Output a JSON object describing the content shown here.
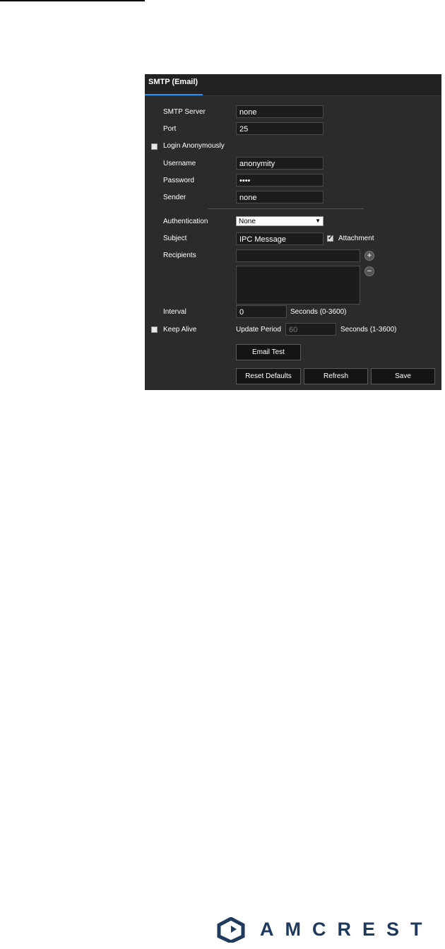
{
  "tab": {
    "title": "SMTP (Email)"
  },
  "fields": {
    "smtp_server": {
      "label": "SMTP Server",
      "value": "none"
    },
    "port": {
      "label": "Port",
      "value": "25"
    },
    "login_anonymously": {
      "label": "Login Anonymously",
      "checked": false
    },
    "username": {
      "label": "Username",
      "value": "anonymity"
    },
    "password": {
      "label": "Password",
      "value": "••••"
    },
    "sender": {
      "label": "Sender",
      "value": "none"
    },
    "authentication": {
      "label": "Authentication",
      "value": "None"
    },
    "subject": {
      "label": "Subject",
      "value": "IPC Message"
    },
    "attachment": {
      "label": "Attachment",
      "checked": true
    },
    "recipients": {
      "label": "Recipients",
      "value": ""
    },
    "interval": {
      "label": "Interval",
      "value": "0",
      "unit": "Seconds (0-3600)"
    },
    "keep_alive": {
      "label": "Keep Alive",
      "checked": false
    },
    "update_period": {
      "label": "Update Period",
      "value": "60",
      "unit": "Seconds (1-3600)"
    }
  },
  "buttons": {
    "email_test": "Email Test",
    "reset_defaults": "Reset Defaults",
    "refresh": "Refresh",
    "save": "Save"
  },
  "logo": {
    "text": "AMCREST"
  },
  "colors": {
    "panel_bg": "#2b2b2b",
    "header_bg": "#222222",
    "accent": "#1e90ff",
    "logo": "#1f3a5c"
  }
}
